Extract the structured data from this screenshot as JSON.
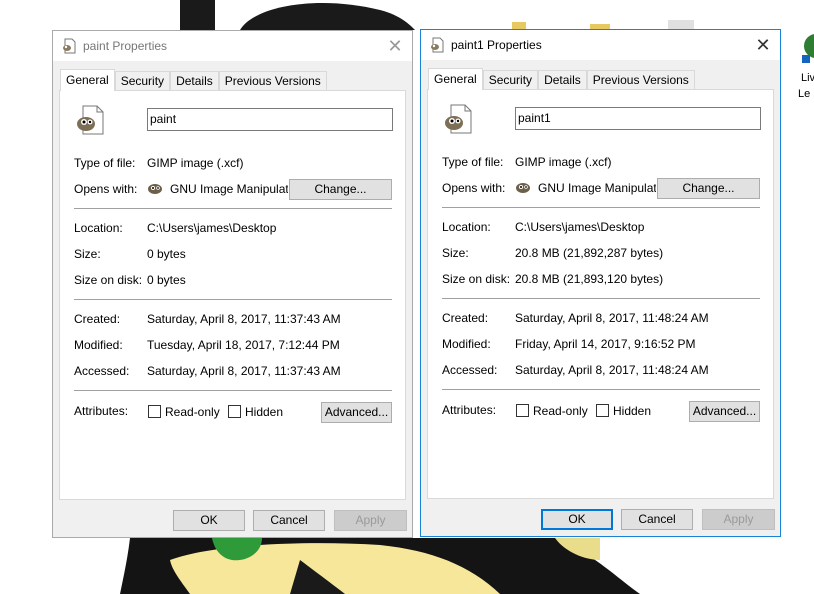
{
  "desktop": {
    "right_icon_label_line1": "Liv",
    "right_icon_label_line2": "Le"
  },
  "dialogs": [
    {
      "title": "paint Properties",
      "state": "inactive",
      "tabs": [
        "General",
        "Security",
        "Details",
        "Previous Versions"
      ],
      "selected_tab": "General",
      "file_name": "paint",
      "type_label": "Type of file:",
      "type_value": "GIMP image (.xcf)",
      "opens_label": "Opens with:",
      "opens_value": "GNU Image Manipulatic",
      "change_label": "Change...",
      "location_label": "Location:",
      "location_value": "C:\\Users\\james\\Desktop",
      "size_label": "Size:",
      "size_value": "0 bytes",
      "size_disk_label": "Size on disk:",
      "size_disk_value": "0 bytes",
      "created_label": "Created:",
      "created_value": "Saturday, April 8, 2017, 11:37:43 AM",
      "modified_label": "Modified:",
      "modified_value": "Tuesday, April 18, 2017, 7:12:44 PM",
      "accessed_label": "Accessed:",
      "accessed_value": "Saturday, April 8, 2017, 11:37:43 AM",
      "attributes_label": "Attributes:",
      "readonly_label": "Read-only",
      "hidden_label": "Hidden",
      "advanced_label": "Advanced...",
      "ok_label": "OK",
      "cancel_label": "Cancel",
      "apply_label": "Apply"
    },
    {
      "title": "paint1 Properties",
      "state": "active",
      "tabs": [
        "General",
        "Security",
        "Details",
        "Previous Versions"
      ],
      "selected_tab": "General",
      "file_name": "paint1",
      "type_label": "Type of file:",
      "type_value": "GIMP image (.xcf)",
      "opens_label": "Opens with:",
      "opens_value": "GNU Image Manipulatic",
      "change_label": "Change...",
      "location_label": "Location:",
      "location_value": "C:\\Users\\james\\Desktop",
      "size_label": "Size:",
      "size_value": "20.8 MB (21,892,287 bytes)",
      "size_disk_label": "Size on disk:",
      "size_disk_value": "20.8 MB (21,893,120 bytes)",
      "created_label": "Created:",
      "created_value": "Saturday, April 8, 2017, 11:48:24 AM",
      "modified_label": "Modified:",
      "modified_value": "Friday, April 14, 2017, 9:16:52 PM",
      "accessed_label": "Accessed:",
      "accessed_value": "Saturday, April 8, 2017, 11:48:24 AM",
      "attributes_label": "Attributes:",
      "readonly_label": "Read-only",
      "hidden_label": "Hidden",
      "advanced_label": "Advanced...",
      "ok_label": "OK",
      "cancel_label": "Cancel",
      "apply_label": "Apply"
    }
  ],
  "colors": {
    "active_border": "#1883d7",
    "inactive_border": "#aaaaaa",
    "dialog_bg": "#f0f0f0"
  }
}
